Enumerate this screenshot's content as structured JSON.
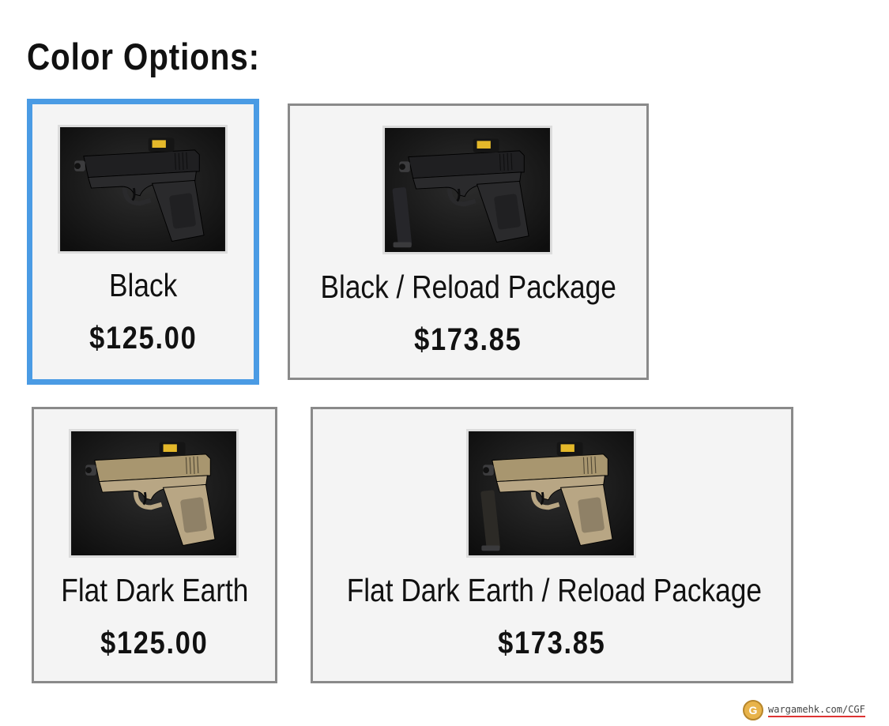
{
  "heading": "Color Options:",
  "options": [
    {
      "name": "Black",
      "price": "$125.00",
      "selected": true,
      "finish": "black",
      "reload_package": false
    },
    {
      "name": "Black / Reload Package",
      "price": "$173.85",
      "selected": false,
      "finish": "black",
      "reload_package": true
    },
    {
      "name": "Flat Dark Earth",
      "price": "$125.00",
      "selected": false,
      "finish": "fde",
      "reload_package": false
    },
    {
      "name": "Flat Dark Earth / Reload Package",
      "price": "$173.85",
      "selected": false,
      "finish": "fde",
      "reload_package": true
    }
  ],
  "colors": {
    "selected_border": "#4a9be4",
    "card_border": "#8a8a8a",
    "card_background": "#f4f4f4",
    "black_finish": "#2a2a2c",
    "fde_finish": "#b8a684"
  },
  "watermark": {
    "text": "wargamehk.com/CGF",
    "logo": "wargamehk-logo-icon"
  }
}
